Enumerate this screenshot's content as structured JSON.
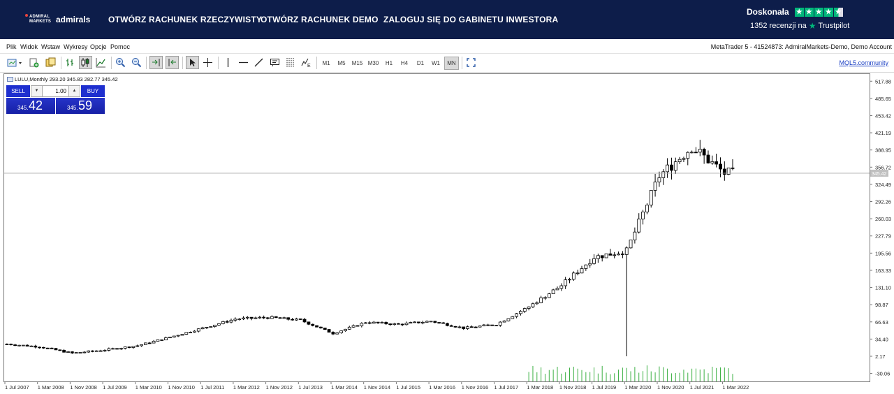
{
  "banner": {
    "logo_small": "ADMIRAL MARKETS",
    "logo_text": "admirals",
    "nav": [
      "OTWÓRZ RACHUNEK RZECZYWISTY",
      "OTWÓRZ RACHUNEK DEMO",
      "ZALOGUJ SIĘ DO GABINETU INWESTORA"
    ],
    "rating_word": "Doskonała",
    "reviews_text": "1352 recenzji na",
    "trustpilot": "Trustpilot",
    "star_color": "#00b67a"
  },
  "menu": {
    "items": [
      "Plik",
      "Widok",
      "Wstaw",
      "Wykresy",
      "Opcje",
      "Pomoc"
    ],
    "window_title": "MetaTrader 5 - 41524873: AdmiralMarkets-Demo, Demo Account"
  },
  "toolbar": {
    "timeframes": [
      "M1",
      "M5",
      "M15",
      "M30",
      "H1",
      "H4",
      "D1",
      "W1",
      "MN"
    ],
    "active_timeframe": "MN",
    "community_link": "MQL5.community"
  },
  "chart": {
    "symbol_line": "LULU,Monthly  293.20 345.83 282.77 345.42",
    "one_click": {
      "sell_label": "SELL",
      "buy_label": "BUY",
      "volume": "1.00",
      "sell_small": "345.",
      "sell_big": "42",
      "buy_small": "345.",
      "buy_big": "59"
    },
    "current_price_label": "345.42"
  },
  "chart_data": {
    "type": "candlestick",
    "symbol": "LULU",
    "timeframe": "Monthly",
    "ohlc_last": {
      "open": 293.2,
      "high": 345.83,
      "low": 282.77,
      "close": 345.42
    },
    "y_ticks": [
      "517.88",
      "485.65",
      "453.42",
      "421.19",
      "388.95",
      "356.72",
      "324.49",
      "292.26",
      "260.03",
      "227.79",
      "195.56",
      "163.33",
      "131.10",
      "98.87",
      "66.63",
      "34.40",
      "2.17",
      "-30.06"
    ],
    "x_ticks": [
      "1 Jul 2007",
      "1 Mar 2008",
      "1 Nov 2008",
      "1 Jul 2009",
      "1 Mar 2010",
      "1 Nov 2010",
      "1 Jul 2011",
      "1 Mar 2012",
      "1 Nov 2012",
      "1 Jul 2013",
      "1 Mar 2014",
      "1 Nov 2014",
      "1 Jul 2015",
      "1 Mar 2016",
      "1 Nov 2016",
      "1 Jul 2017",
      "1 Mar 2018",
      "1 Nov 2018",
      "1 Jul 2019",
      "1 Mar 2020",
      "1 Nov 2020",
      "1 Jul 2021",
      "1 Mar 2022"
    ],
    "ylim": [
      -45,
      530
    ],
    "close_series_yearly": [
      {
        "x": "1 Jul 2007",
        "close": 25
      },
      {
        "x": "1 Mar 2008",
        "close": 20
      },
      {
        "x": "1 Nov 2008",
        "close": 8
      },
      {
        "x": "1 Jul 2009",
        "close": 14
      },
      {
        "x": "1 Mar 2010",
        "close": 22
      },
      {
        "x": "1 Nov 2010",
        "close": 38
      },
      {
        "x": "1 Jul 2011",
        "close": 55
      },
      {
        "x": "1 Mar 2012",
        "close": 72
      },
      {
        "x": "1 Nov 2012",
        "close": 75
      },
      {
        "x": "1 Jul 2013",
        "close": 70
      },
      {
        "x": "1 Mar 2014",
        "close": 45
      },
      {
        "x": "1 Nov 2014",
        "close": 66
      },
      {
        "x": "1 Jul 2015",
        "close": 62
      },
      {
        "x": "1 Mar 2016",
        "close": 68
      },
      {
        "x": "1 Nov 2016",
        "close": 55
      },
      {
        "x": "1 Jul 2017",
        "close": 62
      },
      {
        "x": "1 Mar 2018",
        "close": 95
      },
      {
        "x": "1 Nov 2018",
        "close": 135
      },
      {
        "x": "1 Jul 2019",
        "close": 188
      },
      {
        "x": "1 Mar 2020",
        "close": 200
      },
      {
        "x": "1 Nov 2020",
        "close": 340
      },
      {
        "x": "1 Jul 2021",
        "close": 395
      },
      {
        "x": "1 Mar 2022",
        "close": 345.42
      }
    ],
    "grid": false,
    "current_price_line": 345.42
  },
  "icons": {
    "new_chart": "new-chart-icon",
    "zoom_in": "zoom-in-icon",
    "zoom_out": "zoom-out-icon",
    "cursor": "cursor-icon",
    "crosshair": "crosshair-icon"
  }
}
